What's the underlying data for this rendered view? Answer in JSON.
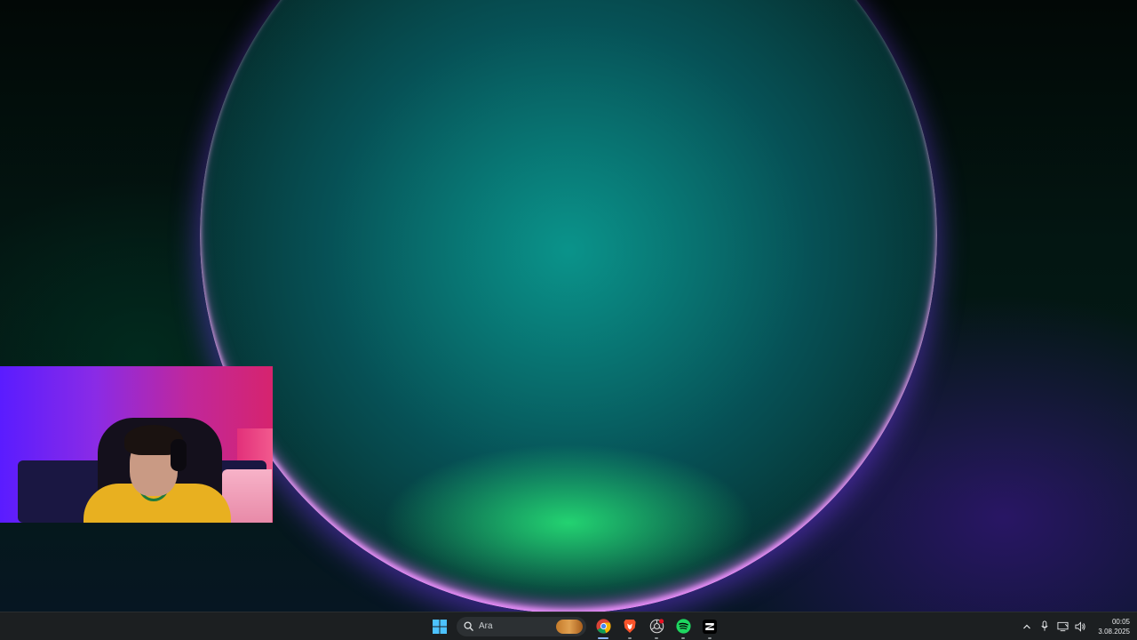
{
  "taskbar": {
    "search": {
      "label": "Ara",
      "icon": "search-icon"
    },
    "apps": [
      {
        "name": "Chrome",
        "icon": "chrome-icon",
        "running": true,
        "active": true
      },
      {
        "name": "Brave",
        "icon": "brave-icon",
        "running": true
      },
      {
        "name": "Camera/Recorder",
        "icon": "record-icon",
        "running": true,
        "badge": true
      },
      {
        "name": "Spotify",
        "icon": "spotify-icon",
        "running": true
      },
      {
        "name": "CapCut",
        "icon": "capcut-icon",
        "running": true
      }
    ],
    "tray": {
      "icons": [
        "chevron-up-icon",
        "microphone-icon",
        "display-icon",
        "speaker-icon"
      ]
    },
    "clock": {
      "time": "00:05",
      "date": "3.08.2025"
    }
  },
  "colors": {
    "taskbar_bg": "#1c1f21",
    "accent": "#8ab4f8"
  }
}
